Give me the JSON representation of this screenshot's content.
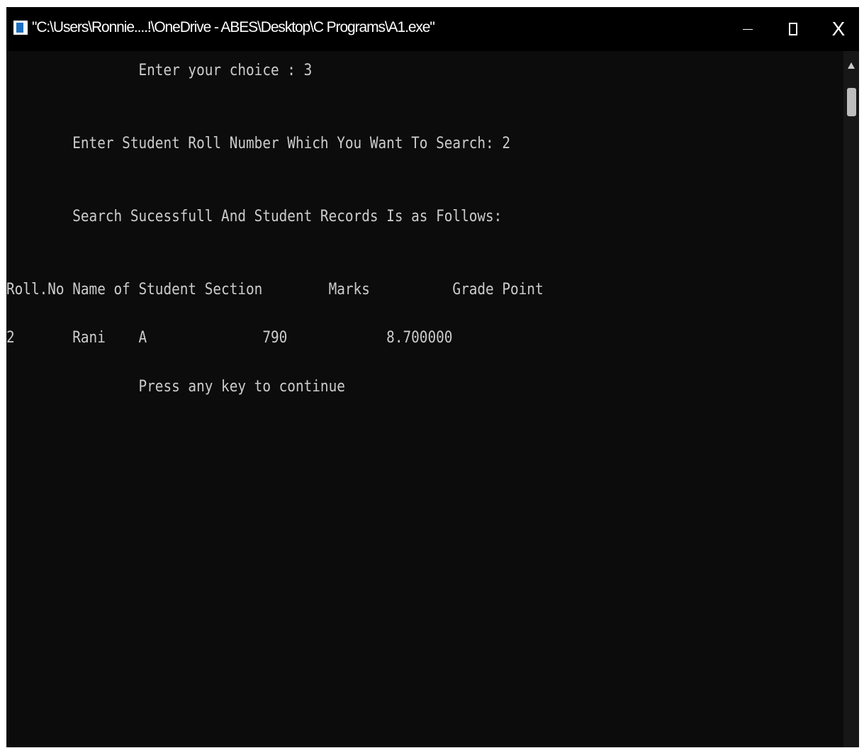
{
  "window": {
    "title": "\"C:\\Users\\Ronnie....!\\OneDrive - ABES\\Desktop\\C Programs\\A1.exe\"",
    "minimize_glyph": "",
    "maximize_glyph": "",
    "close_glyph": "X"
  },
  "console": {
    "lines": [
      "                Enter your choice : 3",
      "        Enter Student Roll Number Which You Want To Search: 2",
      "        Search Sucessfull And Student Records Is as Follows:",
      "Roll.No Name of Student Section        Marks          Grade Point",
      "2       Rani    A              790            8.700000",
      "                Press any key to continue"
    ]
  },
  "colors": {
    "console_bg": "#0c0c0c",
    "console_text": "#cccccc",
    "titlebar_bg": "#000000"
  },
  "icons": {
    "app": "console-app-icon",
    "minimize": "minimize-icon",
    "maximize": "maximize-icon",
    "close": "close-icon",
    "scroll_up": "scroll-up-arrow-icon"
  }
}
